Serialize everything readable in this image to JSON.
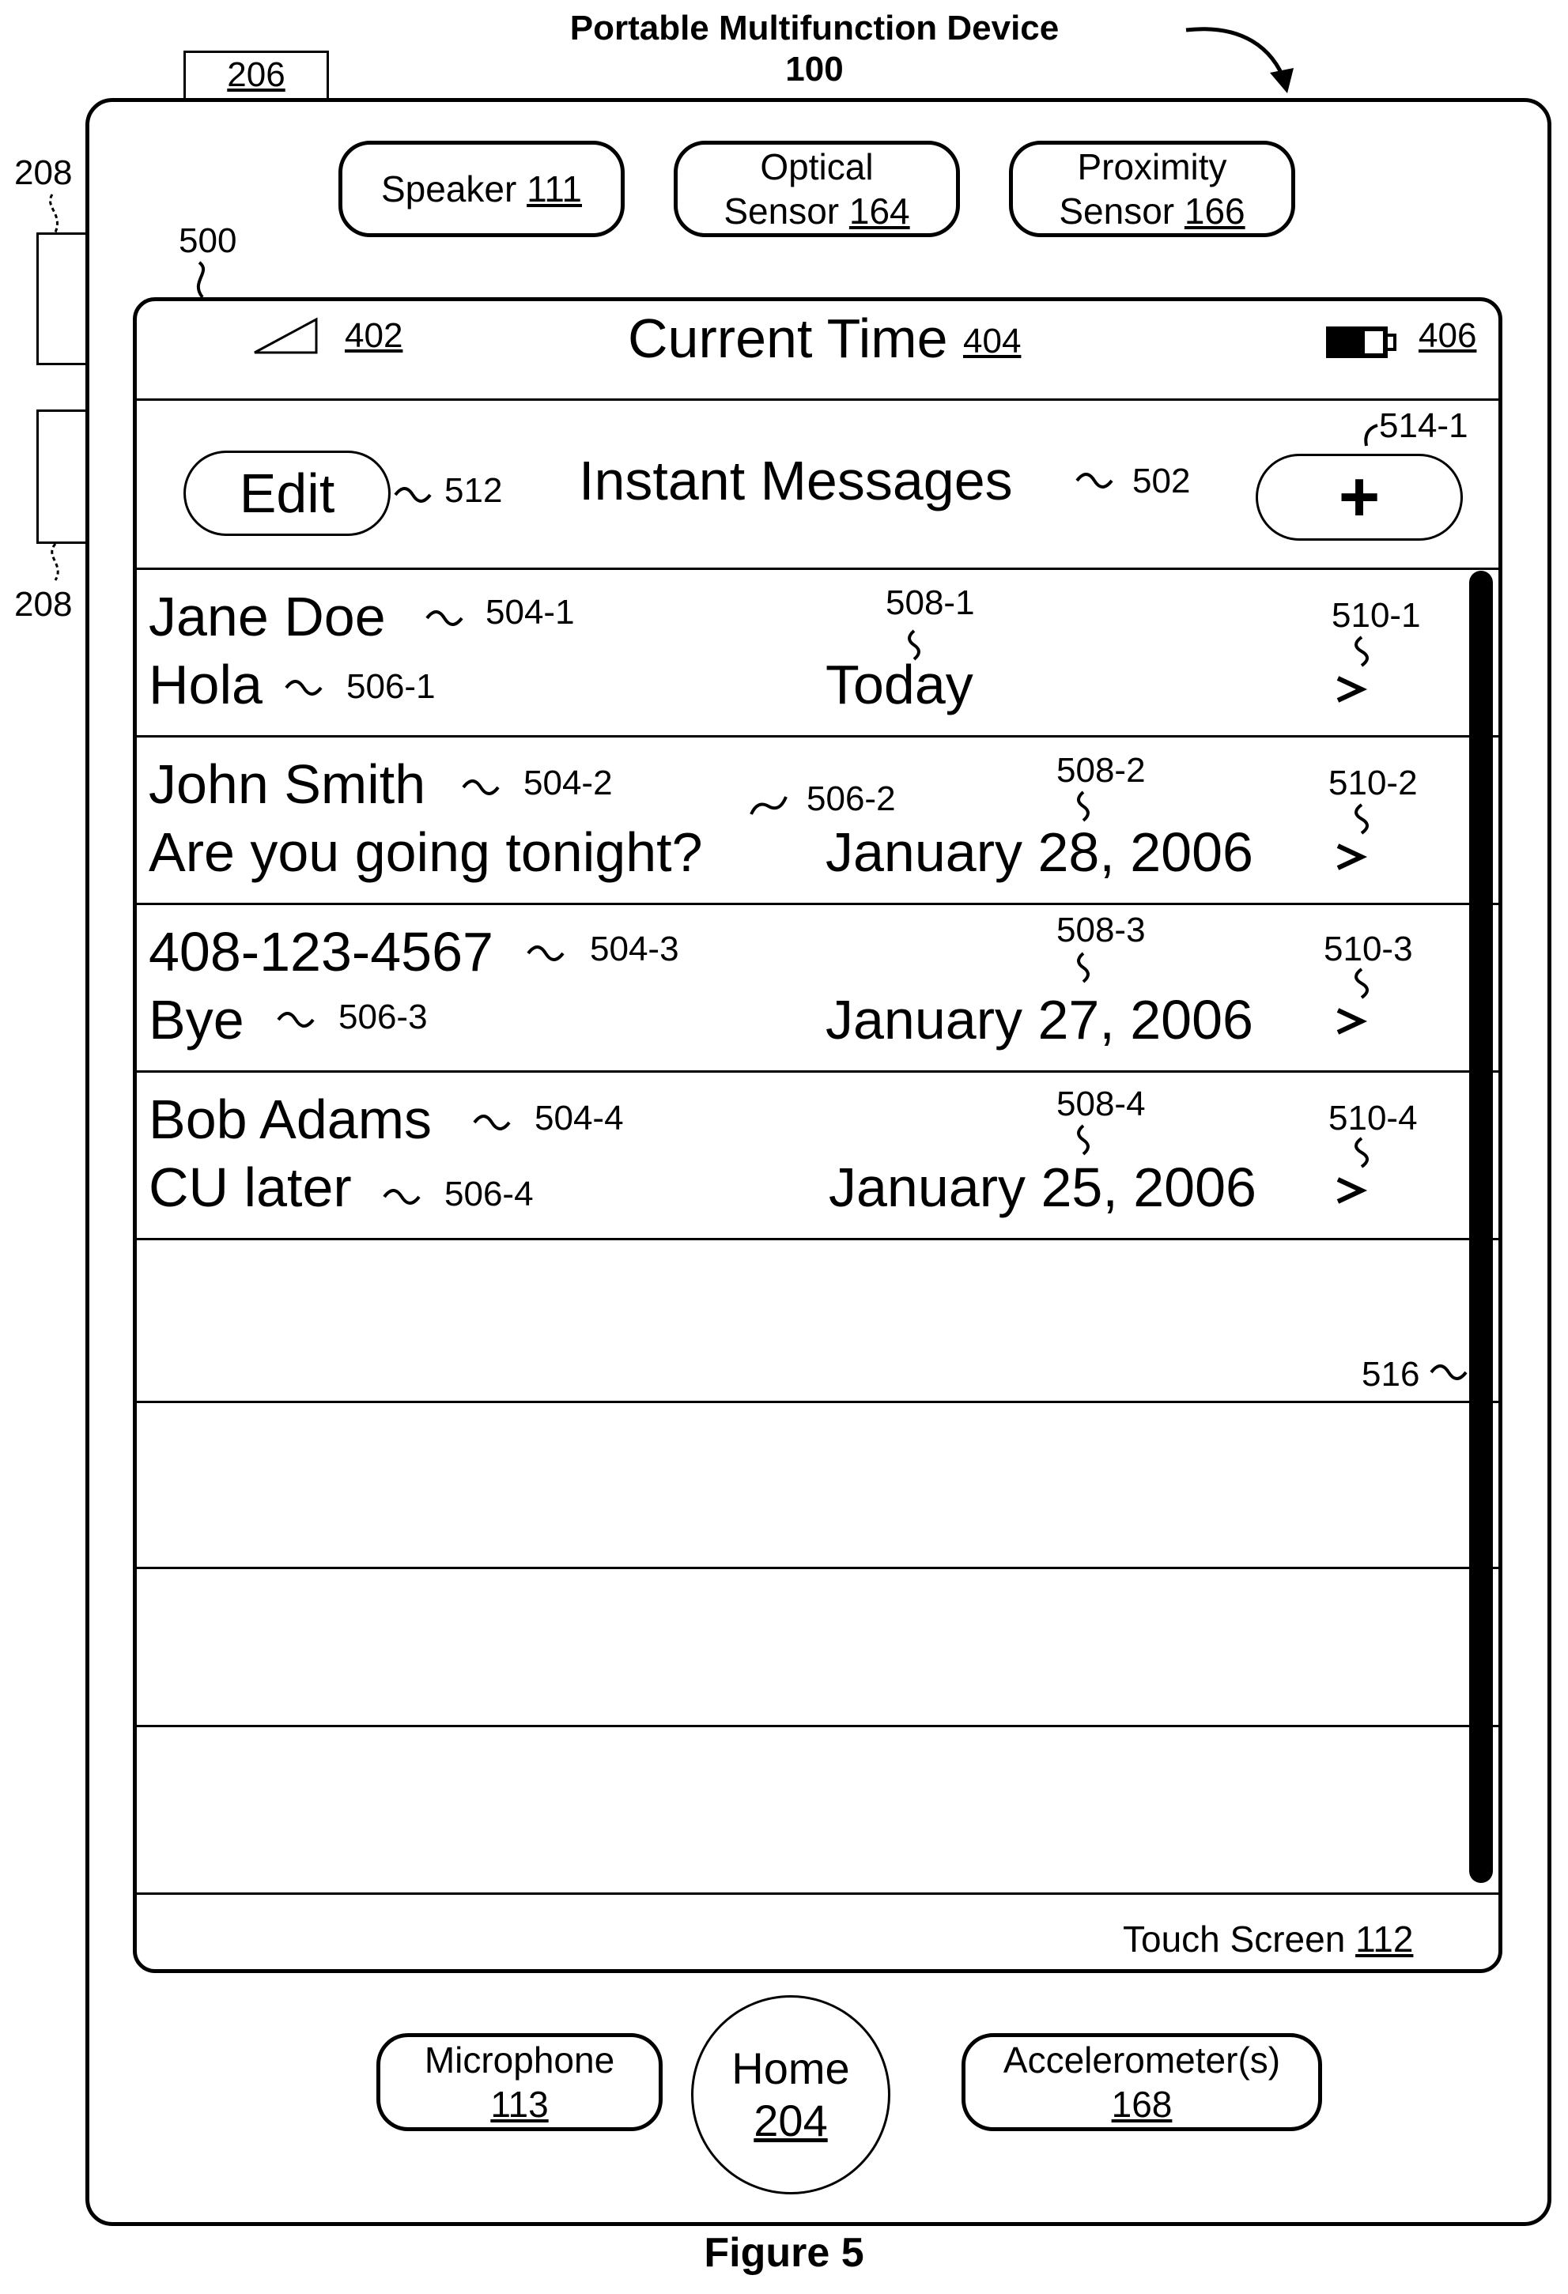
{
  "figure_label": "Figure 5",
  "device": {
    "title": "Portable Multifunction Device",
    "number": "100",
    "ref_206": "206",
    "ref_208_top": "208",
    "ref_208_bottom": "208",
    "ref_500": "500"
  },
  "hardware": {
    "speaker": {
      "label": "Speaker",
      "num": "111"
    },
    "optical": {
      "line1": "Optical",
      "line2": "Sensor",
      "num": "164"
    },
    "proximity": {
      "line1": "Proximity",
      "line2": "Sensor",
      "num": "166"
    },
    "microphone": {
      "label": "Microphone",
      "num": "113"
    },
    "home": {
      "label": "Home",
      "num": "204"
    },
    "accelerometer": {
      "label": "Accelerometer(s)",
      "num": "168"
    }
  },
  "status_bar": {
    "signal_ref": "402",
    "time_label": "Current Time",
    "time_ref": "404",
    "battery_ref": "406"
  },
  "toolbar": {
    "edit_label": "Edit",
    "edit_ref": "512",
    "title": "Instant Messages",
    "title_ref": "502",
    "add_label": "+",
    "add_ref": "514-1"
  },
  "messages": [
    {
      "name": "Jane Doe",
      "name_ref": "504-1",
      "preview": "Hola",
      "preview_ref": "506-1",
      "date": "Today",
      "date_ref": "508-1",
      "chevron_ref": "510-1"
    },
    {
      "name": "John Smith",
      "name_ref": "504-2",
      "preview": "Are you going tonight?",
      "preview_ref": "506-2",
      "date": "January 28, 2006",
      "date_ref": "508-2",
      "chevron_ref": "510-2"
    },
    {
      "name": "408-123-4567",
      "name_ref": "504-3",
      "preview": "Bye",
      "preview_ref": "506-3",
      "date": "January 27, 2006",
      "date_ref": "508-3",
      "chevron_ref": "510-3"
    },
    {
      "name": "Bob Adams",
      "name_ref": "504-4",
      "preview": "CU later",
      "preview_ref": "506-4",
      "date": "January 25, 2006",
      "date_ref": "508-4",
      "chevron_ref": "510-4"
    }
  ],
  "scrollbar_ref": "516",
  "touch_screen": {
    "label": "Touch Screen",
    "num": "112"
  }
}
